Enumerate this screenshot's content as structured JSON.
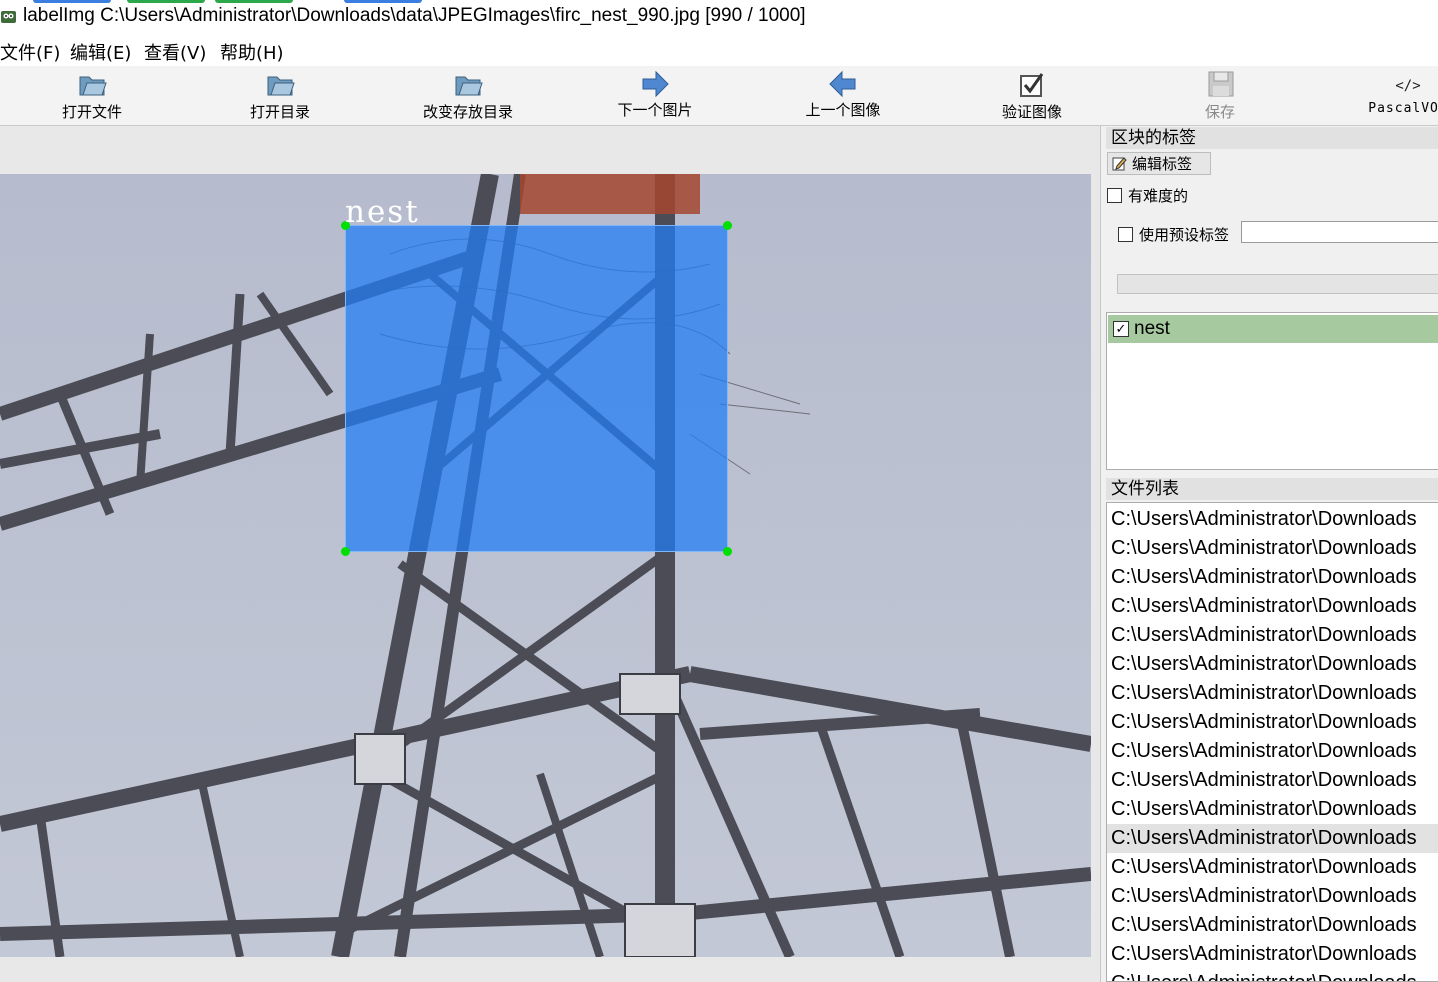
{
  "window": {
    "title": "labelImg C:\\Users\\Administrator\\Downloads\\data\\JPEGImages\\firc_nest_990.jpg [990 / 1000]"
  },
  "menu": [
    "文件(F)",
    "编辑(E)",
    "查看(V)",
    "帮助(H)"
  ],
  "toolbar": {
    "open_file": "打开文件",
    "open_dir": "打开目录",
    "change_save_dir": "改变存放目录",
    "next_image": "下一个图片",
    "prev_image": "上一个图像",
    "verify_image": "验证图像",
    "save": "保存",
    "format": "PascalVOC"
  },
  "annotation": {
    "label": "nest",
    "box_color": "#237df5"
  },
  "label_panel": {
    "title": "区块的标签",
    "edit_label_button": "编辑标签",
    "difficult_checkbox": "有难度的",
    "use_default_label": "使用预设标签",
    "default_label_value": "",
    "labels": [
      {
        "name": "nest",
        "checked": true
      }
    ]
  },
  "file_panel": {
    "title": "文件列表",
    "files": [
      "C:\\Users\\Administrator\\Downloads",
      "C:\\Users\\Administrator\\Downloads",
      "C:\\Users\\Administrator\\Downloads",
      "C:\\Users\\Administrator\\Downloads",
      "C:\\Users\\Administrator\\Downloads",
      "C:\\Users\\Administrator\\Downloads",
      "C:\\Users\\Administrator\\Downloads",
      "C:\\Users\\Administrator\\Downloads",
      "C:\\Users\\Administrator\\Downloads",
      "C:\\Users\\Administrator\\Downloads",
      "C:\\Users\\Administrator\\Downloads",
      "C:\\Users\\Administrator\\Downloads",
      "C:\\Users\\Administrator\\Downloads",
      "C:\\Users\\Administrator\\Downloads",
      "C:\\Users\\Administrator\\Downloads",
      "C:\\Users\\Administrator\\Downloads",
      "C:\\Users\\Administrator\\Downloads"
    ],
    "selected_index": 11
  }
}
